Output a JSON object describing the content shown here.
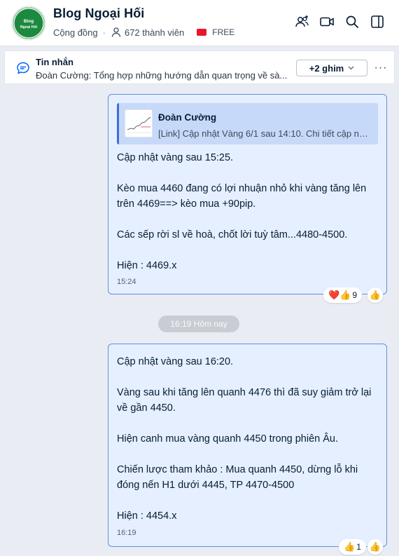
{
  "header": {
    "title": "Blog Ngoại Hối",
    "avatar_text": "Blog Ngoại Hối",
    "category": "Cộng đồng",
    "members": "672 thành viên",
    "plan": "FREE",
    "icons": [
      "add-member-icon",
      "video-call-icon",
      "search-icon",
      "sidebar-toggle-icon"
    ]
  },
  "pinned": {
    "label": "Tin nhắn",
    "text": "Đoàn Cường: Tổng hợp những hướng dẫn quan trọng về sà...",
    "pin_button": "+2 ghim",
    "more": "···"
  },
  "messages": [
    {
      "quote": {
        "author": "Đoàn Cường",
        "text": "[Link] Cập nhật Vàng 6/1 sau 14:10. Chi tiết cập nhậ..."
      },
      "body": "Cập nhật vàng sau 15:25.\n\nKèo mua 4460 đang có lợi nhuận nhỏ khi vàng tăng lên trên 4469==> kèo mua +90pip.\n\nCác sếp rời sl về hoà, chốt lời tuỳ tâm...4480-4500.\n\nHiện : 4469.x",
      "time": "15:24",
      "reactions": {
        "emojis": "❤️👍",
        "count": "9"
      },
      "react_button": "👍"
    },
    {
      "body": "Cập nhật vàng sau 16:20.\n\nVàng sau khi tăng lên quanh 4476 thì đã suy giảm trở lại về gần 4450.\n\nHiện canh mua vàng quanh 4450 trong phiên Âu.\n\nChiến lược tham khảo : Mua quanh 4450, dừng lỗ khi đóng nến H1 dưới 4445, TP 4470-4500\n\nHiện : 4454.x",
      "time": "16:19",
      "reactions": {
        "emojis": "👍",
        "count": "1"
      },
      "react_button": "👍"
    }
  ],
  "divider": "16:19 Hôm nay",
  "colors": {
    "bubble": "#e5efff",
    "bubble_border": "#5e8fe0",
    "avatar_green": "#1c8a3e",
    "free_flag": "#e5182d"
  }
}
